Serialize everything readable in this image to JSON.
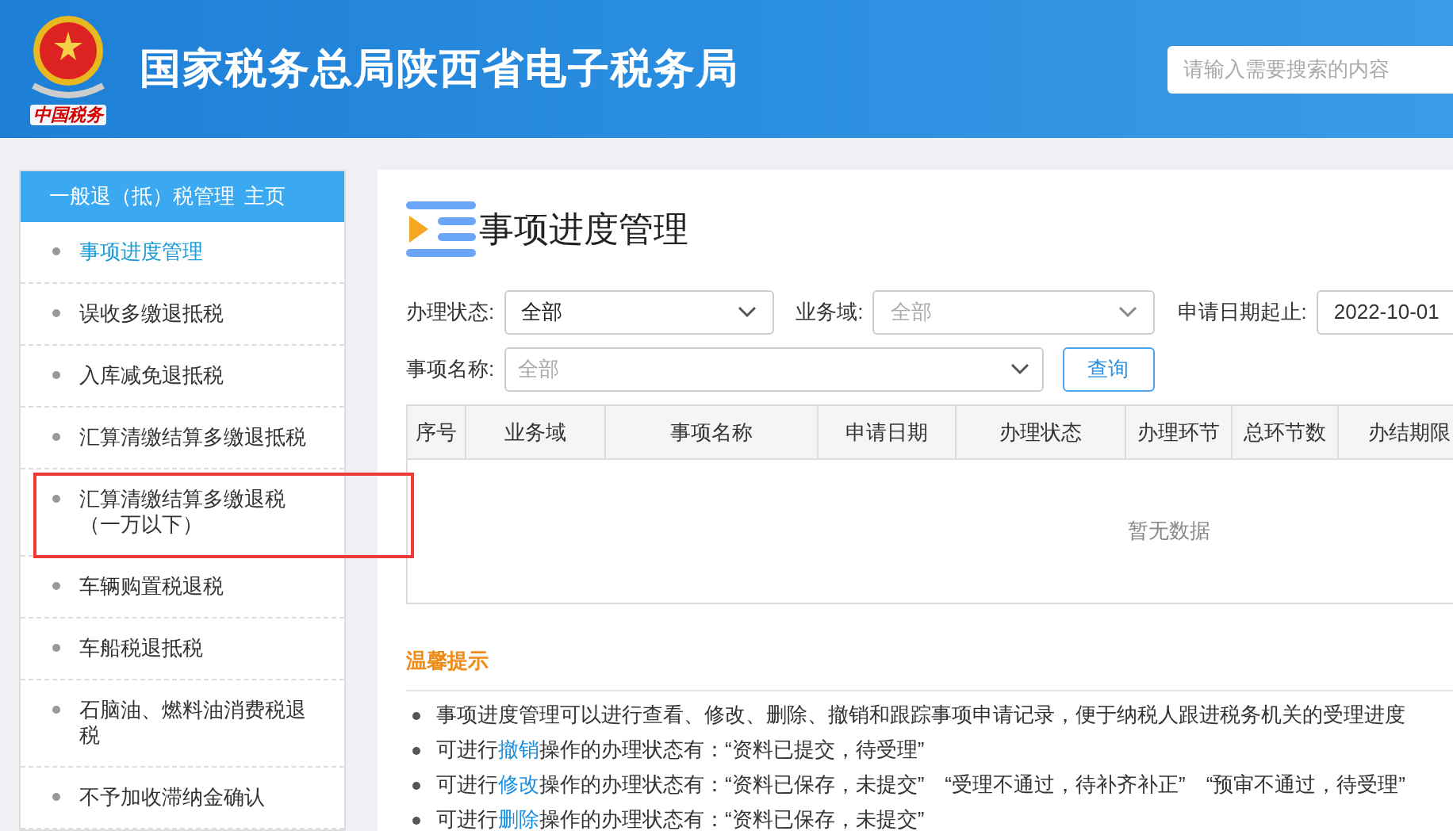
{
  "header": {
    "logo_text": "中国税务",
    "title": "国家税务总局陕西省电子税务局",
    "search": {
      "placeholder": "请输入需要搜索的内容"
    }
  },
  "sidebar": {
    "title": "一般退（抵）税管理",
    "home_link": "主页",
    "items": [
      {
        "label": "事项进度管理",
        "selected": true,
        "highlighted": false
      },
      {
        "label": "误收多缴退抵税",
        "selected": false,
        "highlighted": false
      },
      {
        "label": "入库减免退抵税",
        "selected": false,
        "highlighted": false
      },
      {
        "label": "汇算清缴结算多缴退抵税",
        "selected": false,
        "highlighted": false
      },
      {
        "label": "汇算清缴结算多缴退税",
        "sublabel": "（一万以下）",
        "selected": false,
        "highlighted": true
      },
      {
        "label": "车辆购置税退税",
        "selected": false,
        "highlighted": false
      },
      {
        "label": "车船税退抵税",
        "selected": false,
        "highlighted": false
      },
      {
        "label": "石脑油、燃料油消费税退税",
        "selected": false,
        "highlighted": false
      },
      {
        "label": "不予加收滞纳金确认",
        "selected": false,
        "highlighted": false
      }
    ]
  },
  "page": {
    "title": "事项进度管理",
    "filters": [
      {
        "label": "办理状态:",
        "value": "全部"
      },
      {
        "label": "业务域:",
        "placeholder": "全部"
      },
      {
        "label": "申请日期起止:",
        "value": "2022-10-01",
        "kind": "date"
      }
    ],
    "filters_row2": {
      "label": "事项名称:",
      "placeholder": "全部",
      "button": "查询"
    },
    "table": {
      "columns": [
        "序号",
        "业务域",
        "事项名称",
        "申请日期",
        "办理状态",
        "办理环节",
        "总环节数",
        "办结期限"
      ],
      "empty_text": "暂无数据"
    },
    "tips": {
      "title": "温馨提示",
      "items": [
        [
          {
            "text": "事项进度管理可以进行查看、修改、删除、撤销和跟踪事项申请记录，便于纳税人跟进税务机关的受理进度",
            "link": false
          }
        ],
        [
          {
            "text": "可进行",
            "link": false
          },
          {
            "text": "撤销",
            "link": true
          },
          {
            "text": "操作的办理状态有：“资料已提交，待受理”",
            "link": false
          }
        ],
        [
          {
            "text": "可进行",
            "link": false
          },
          {
            "text": "修改",
            "link": true
          },
          {
            "text": "操作的办理状态有：“资料已保存，未提交”　“受理不通过，待补齐补正”　“预审不通过，待受理”",
            "link": false
          }
        ],
        [
          {
            "text": "可进行",
            "link": false
          },
          {
            "text": "删除",
            "link": true
          },
          {
            "text": "操作的办理状态有：“资料已保存，未提交”",
            "link": false
          }
        ]
      ]
    }
  }
}
